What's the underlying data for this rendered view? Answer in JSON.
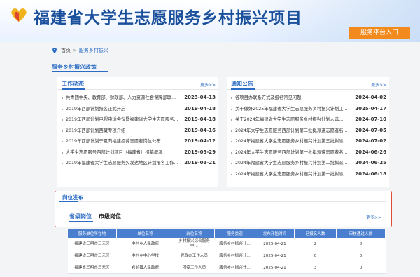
{
  "header": {
    "site_title": "福建省大学生志愿服务乡村振兴项目",
    "portal_button": "服务平台入口",
    "logo_icon": "heart-logo-icon"
  },
  "breadcrumb": {
    "home": "首页",
    "separator": ">",
    "current": "服务乡村振兴"
  },
  "section": {
    "title": "服务乡村振兴政策"
  },
  "work_news": {
    "title": "工作动态",
    "more": "更多>>",
    "items": [
      {
        "title": "共青团中央、教育部、财政部、人力资源社会保障部联...",
        "date": "2023-04-13"
      },
      {
        "title": "2019年西部计划报名正式开启",
        "date": "2019-04-18"
      },
      {
        "title": "2019年西部计划电视电话会议暨福建省大学生志愿服务...",
        "date": "2019-04-18"
      },
      {
        "title": "2019年西部计划西藏专项介绍",
        "date": "2019-04-16"
      },
      {
        "title": "2019年西部计划宁夏向福建招募志愿者岗位公布",
        "date": "2019-04-12"
      },
      {
        "title": "大学生志愿服务西部计划项目（福建省）招募概况",
        "date": "2019-03-29"
      },
      {
        "title": "2019年福建省大学生志愿服务欠发达地区计划报名工作...",
        "date": "2019-03-21"
      }
    ]
  },
  "notices": {
    "title": "通知公告",
    "more": "更多>>",
    "items": [
      {
        "title": "各项目办联系方式及报名常见问题",
        "date": "2024-04-02"
      },
      {
        "title": "关于做好2025年福建省大学生志愿服务乡村振兴计划工...",
        "date": "2025-04-17"
      },
      {
        "title": "关于2024年福建省大学生志愿服务乡村振兴计划人选...",
        "date": "2024-07-10"
      },
      {
        "title": "2024年大学生志愿服务西部计划第二批拟派遣志愿者名...",
        "date": "2024-07-05"
      },
      {
        "title": "2024年福建省大学生志愿服务乡村振兴计划第三批拟派...",
        "date": "2024-07-02"
      },
      {
        "title": "2024年大学生志愿服务西部计划第一批拟派遣志愿者名...",
        "date": "2024-06-26"
      },
      {
        "title": "2024年福建省大学生志愿服务乡村振兴计划第二批拟派...",
        "date": "2024-06-25"
      },
      {
        "title": "2024年福建省大学生志愿服务乡村振兴计划第一批拟派...",
        "date": "2024-06-18"
      }
    ]
  },
  "recruit": {
    "title": "岗位发布",
    "tab_province": "省级岗位",
    "tab_city": "市级岗位",
    "more": "更多>>"
  },
  "jobs_table": {
    "headers": [
      "服务单位所在地",
      "单位名称",
      "岗位名称",
      "服务类别",
      "发布开始时间",
      "已报名人数",
      "审核通过人数"
    ],
    "rows": [
      [
        "福建省三明市三元区",
        "中村乡人民政府",
        "乡村振兴综合服务中...",
        "服务乡村振兴计...",
        "2025-04-21",
        "2",
        "0"
      ],
      [
        "福建省三明市三元区",
        "中村乡中心学校",
        "党政办工作人员",
        "服务乡村振兴计...",
        "2025-04-21",
        "0",
        "0"
      ],
      [
        "福建省三明市三元区",
        "岩前镇人民政府",
        "团委工作人员",
        "服务乡村振兴计...",
        "2025-04-21",
        "3",
        "0"
      ]
    ]
  },
  "colors": {
    "brand_blue": "#1a4f9c",
    "link_blue": "#2a6bc4",
    "accent_orange": "#f28a1e",
    "highlight_red": "#e04a3c",
    "table_header": "#4a7fd0"
  }
}
